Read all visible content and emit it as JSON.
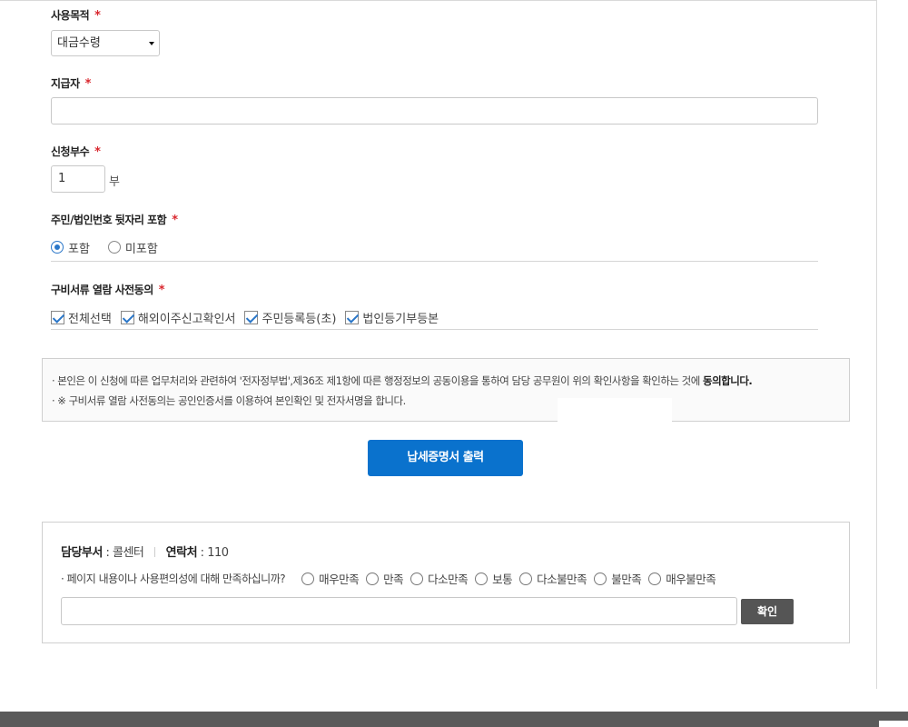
{
  "form": {
    "purpose": {
      "label": "사용목적",
      "required_mark": "*",
      "selected": "대금수령"
    },
    "payer": {
      "label": "지급자",
      "required_mark": "*",
      "value": ""
    },
    "copies": {
      "label": "신청부수",
      "required_mark": "*",
      "value": "1",
      "unit": "부"
    },
    "id_back": {
      "label": "주민/법인번호 뒷자리 포함",
      "required_mark": "*",
      "options": [
        {
          "label": "포함",
          "checked": true
        },
        {
          "label": "미포함",
          "checked": false
        }
      ]
    },
    "docs_consent": {
      "label": "구비서류 열람 사전동의",
      "required_mark": "*",
      "options": [
        {
          "label": "전체선택",
          "checked": true
        },
        {
          "label": "해외이주신고확인서",
          "checked": true
        },
        {
          "label": "주민등록등(초)",
          "checked": true
        },
        {
          "label": "법인등기부등본",
          "checked": true
        }
      ]
    }
  },
  "notice": {
    "line1_prefix": "· 본인은 이 신청에 따른 업무처리와 관련하여 '전자정부법',제36조 제1항에 따른 행정정보의 공동이용을 통하여 담당 공무원이 위의 확인사항을 확인하는 것에 ",
    "line1_bold": "동의합니다.",
    "line2": "· ※ 구비서류 열람 사전동의는 공인인증서를 이용하여 본인확인 및 전자서명을 합니다."
  },
  "print_button": "납세증명서 출력",
  "survey": {
    "dept_label": "담당부서",
    "dept_value": " : 콜센터",
    "contact_label": "연락처",
    "contact_value": " : 110",
    "question": "·  페이지 내용이나 사용편의성에 대해 만족하십니까?",
    "options": [
      "매우만족",
      "만족",
      "다소만족",
      "보통",
      "다소불만족",
      "불만족",
      "매우불만족"
    ],
    "confirm": "확인"
  },
  "colors": {
    "primary": "#0a72cd",
    "required": "#d9272e",
    "check": "#2b77c9",
    "dark_button": "#555555",
    "footer": "#5a5a5a"
  }
}
